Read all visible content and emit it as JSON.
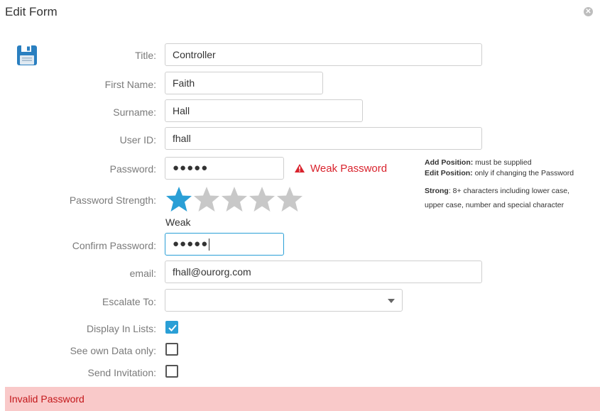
{
  "dialog": {
    "title": "Edit Form",
    "close_icon": "close-icon",
    "save_icon": "floppy-save-icon"
  },
  "fields": {
    "title": {
      "label": "Title:",
      "value": "Controller"
    },
    "first_name": {
      "label": "First Name:",
      "value": "Faith"
    },
    "surname": {
      "label": "Surname:",
      "value": "Hall"
    },
    "user_id": {
      "label": "User ID:",
      "value": "fhall"
    },
    "password": {
      "label": "Password:",
      "value": "●●●●●"
    },
    "password_strength": {
      "label": "Password Strength:",
      "rating": 1,
      "max": 5,
      "text": "Weak"
    },
    "confirm_password": {
      "label": "Confirm Password:",
      "value": "●●●●●"
    },
    "email": {
      "label": "email:",
      "value": "fhall@ourorg.com"
    },
    "escalate_to": {
      "label": "Escalate To:",
      "value": ""
    },
    "display_in_lists": {
      "label": "Display In Lists:",
      "checked": true
    },
    "see_own_data_only": {
      "label": "See own Data only:",
      "checked": false
    },
    "send_invitation": {
      "label": "Send Invitation:",
      "checked": false
    }
  },
  "password_warning": {
    "text": "Weak Password",
    "color": "#d9232d"
  },
  "help": {
    "add_bold": "Add Position:",
    "add_text": " must be supplied",
    "edit_bold": "Edit Position:",
    "edit_text": " only if changing the Password",
    "strong_bold": "Strong",
    "strong_text": ": 8+ characters including lower case,",
    "strong_line2": "upper case, number and special character"
  },
  "error": {
    "text": "Invalid Password"
  },
  "colors": {
    "accent": "#2a9fd6",
    "error_bg": "#f9c9c9",
    "star_empty": "#c8c8c8"
  }
}
